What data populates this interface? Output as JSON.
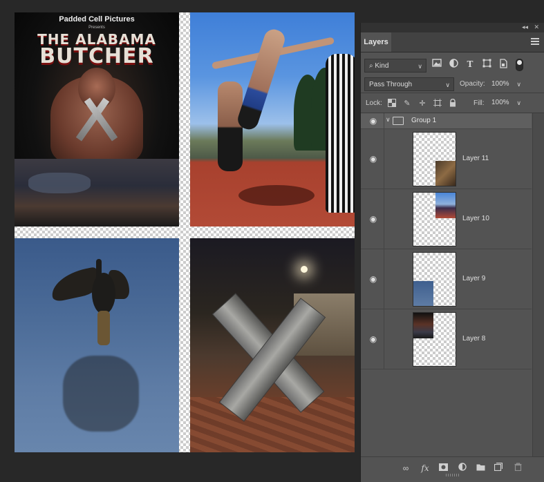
{
  "document": {
    "poster": {
      "studio": "Padded Cell Pictures",
      "presents": "Presents",
      "title_line1": "THE ALABAMA",
      "title_line2": "BUTCHER"
    }
  },
  "panel": {
    "collapse_glyph": "◂◂",
    "close_glyph": "✕",
    "tab_label": "Layers",
    "filter": {
      "kind_label": "Kind",
      "icons": [
        "pixel-filter-icon",
        "adjustment-filter-icon",
        "type-filter-icon",
        "shape-filter-icon",
        "smart-object-filter-icon"
      ]
    },
    "blend": {
      "mode": "Pass Through",
      "opacity_label": "Opacity:",
      "opacity_value": "100%"
    },
    "lock": {
      "label": "Lock:",
      "fill_label": "Fill:",
      "fill_value": "100%"
    },
    "group": {
      "name": "Group 1",
      "expanded": true
    },
    "layers": [
      {
        "name": "Layer 11",
        "visible": true
      },
      {
        "name": "Layer 10",
        "visible": true
      },
      {
        "name": "Layer 9",
        "visible": true
      },
      {
        "name": "Layer 8",
        "visible": true
      }
    ],
    "footer_icons": [
      "link-layers-icon",
      "fx-icon",
      "add-mask-icon",
      "adjustment-layer-icon",
      "new-group-icon",
      "new-layer-icon",
      "delete-layer-icon"
    ]
  },
  "colors": {
    "app_bg": "#282828",
    "panel_bg": "#535353",
    "panel_header": "#424242",
    "group_row": "#5f5f5f"
  }
}
